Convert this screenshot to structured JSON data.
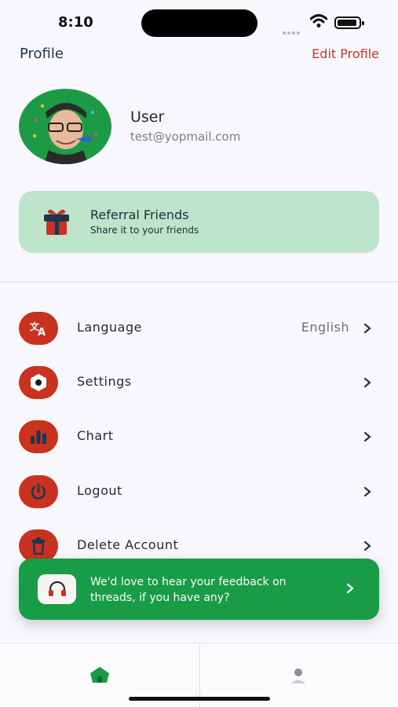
{
  "status_bar": {
    "time": "8:10"
  },
  "header": {
    "title": "Profile",
    "edit_label": "Edit Profile"
  },
  "user": {
    "name": "User",
    "email": "test@yopmail.com"
  },
  "referral": {
    "title": "Referral Friends",
    "subtitle": "Share it to your friends"
  },
  "menu": [
    {
      "label": "Language",
      "value": "English",
      "icon": "translate-icon"
    },
    {
      "label": "Settings",
      "value": "",
      "icon": "settings-icon"
    },
    {
      "label": "Chart",
      "value": "",
      "icon": "chart-icon"
    },
    {
      "label": "Logout",
      "value": "",
      "icon": "power-icon"
    },
    {
      "label": "Delete Account",
      "value": "",
      "icon": "trash-icon"
    }
  ],
  "feedback": {
    "text": "We'd love to hear your feedback on threads, if you have any?",
    "icon": "headphones-icon"
  },
  "tabbar": {
    "tabs": [
      {
        "icon": "home-icon",
        "active": true
      },
      {
        "icon": "profile-icon",
        "active": false
      }
    ]
  },
  "colors": {
    "accent_green": "#189c47",
    "accent_red": "#c8321e",
    "referral_bg": "#bfe4cc"
  }
}
